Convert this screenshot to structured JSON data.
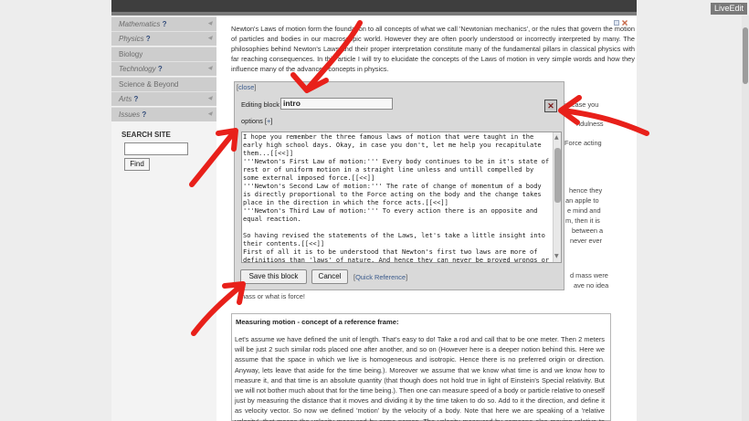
{
  "liveedit_label": "LiveEdit",
  "nav": [
    {
      "label": "Mathematics",
      "suffix": " ?",
      "italic": true,
      "arrow": true
    },
    {
      "label": "Physics",
      "suffix": " ?",
      "italic": true,
      "arrow": true
    },
    {
      "label": "Biology",
      "suffix": "",
      "italic": false,
      "arrow": false
    },
    {
      "label": "Technology",
      "suffix": " ?",
      "italic": true,
      "arrow": true
    },
    {
      "label": "Science & Beyond",
      "suffix": "",
      "italic": false,
      "arrow": false
    },
    {
      "label": "Arts",
      "suffix": " ?",
      "italic": true,
      "arrow": true
    },
    {
      "label": "Issues",
      "suffix": " ?",
      "italic": true,
      "arrow": true
    }
  ],
  "search": {
    "title": "SEARCH SITE",
    "button": "Find",
    "value": ""
  },
  "intro_text": "Newton's Laws of motion form the foundation to all concepts of what we call 'Newtonian mechanics', or the rules that govern the motion of particles and bodies in our macroscopic world. However they are often poorly understood or incorrectly interpreted by many. The philosophies behind Newton's Laws and their proper interpretation constitute many of the fundamental pillars in classical physics with far reaching consequences. In this article I will try to elucidate the concepts of the Laws of motion in very simple words and how they influence many of the advanced concepts in physics.",
  "right_fragments": [
    "in case you",
    "ndulness",
    "Force acting",
    "hence they",
    "an apple to",
    "e mind and",
    "m, then it is",
    "between a",
    "never ever",
    "d mass were",
    "ave no idea"
  ],
  "editor": {
    "close_link": "close",
    "editing_label": "Editing block",
    "block_name": "intro",
    "close_x": "✕",
    "options_label": "options",
    "options_toggle": "+",
    "text_lines": [
      "I hope you remember the three famous laws of motion that were taught in the",
      "early high school days. Okay, in case you don't, let me help you recapitulate",
      "them...[[<<]]",
      "'''Newton's First Law of motion:''' Every body continues to be in it's state of",
      "rest or of uniform motion in a straight line unless and untill compelled by",
      "some external imposed force.[[<<]]",
      "'''Newton's Second Law of motion:''' The rate of change of momentum of a body",
      "is directly proportional to the Force acting on the body and the change takes",
      "place in the direction in which the force acts.[[<<]]",
      "'''Newton's Third Law of motion:''' To every action there is an opposite and",
      "equal reaction.",
      "",
      "So having revised the statements of the Laws, let's take a little insight into",
      "their contents.[[<<]]",
      "First of all it is to be understood that Newton's first two laws are more of",
      "definitions than 'laws' of nature. And hence they can never be proved wrongs or"
    ],
    "save_button": "Save this block",
    "cancel_button": "Cancel",
    "quick_ref": "Quick Reference"
  },
  "below_fragment": "mass or what is force!",
  "measure": {
    "title": "Measuring motion - concept of a reference frame:",
    "text": "Let's assume we have defined the unit of length. That's easy to do! Take a rod and call that to be one meter. Then 2 meters will be just 2 such similar rods placed one after another, and so on (However here is a deeper notion behind this. Here we assume that the space in which we live is homogeneous and isotropic. Hence there is no preferred origin or direction. Anyway, lets leave that aside for the time being.). Moreover we assume that we know what time is and we know how to measure it, and that time is an absolute quantity (that though does not hold true in light of Einstein's Special relativity. But we will not bother much about that for the time being.). Then one can measure speed of a body or particle relative to oneself just by measuring the distance that it moves and dividing it by the time taken to do so. Add to it the direction, and define it as velocity vector. So now we defined 'motion' by the velocity of a body. Note that here we are speaking of a 'relative velocity', that means the velocity measured by some person. The velocity measured by someone else moving relative to this person"
  },
  "colors": {
    "annotation_arrow": "#e8201a",
    "top_bar": "#3e3e3e",
    "nav_background": "#cdcdcd",
    "link": "#3a5a8c"
  }
}
